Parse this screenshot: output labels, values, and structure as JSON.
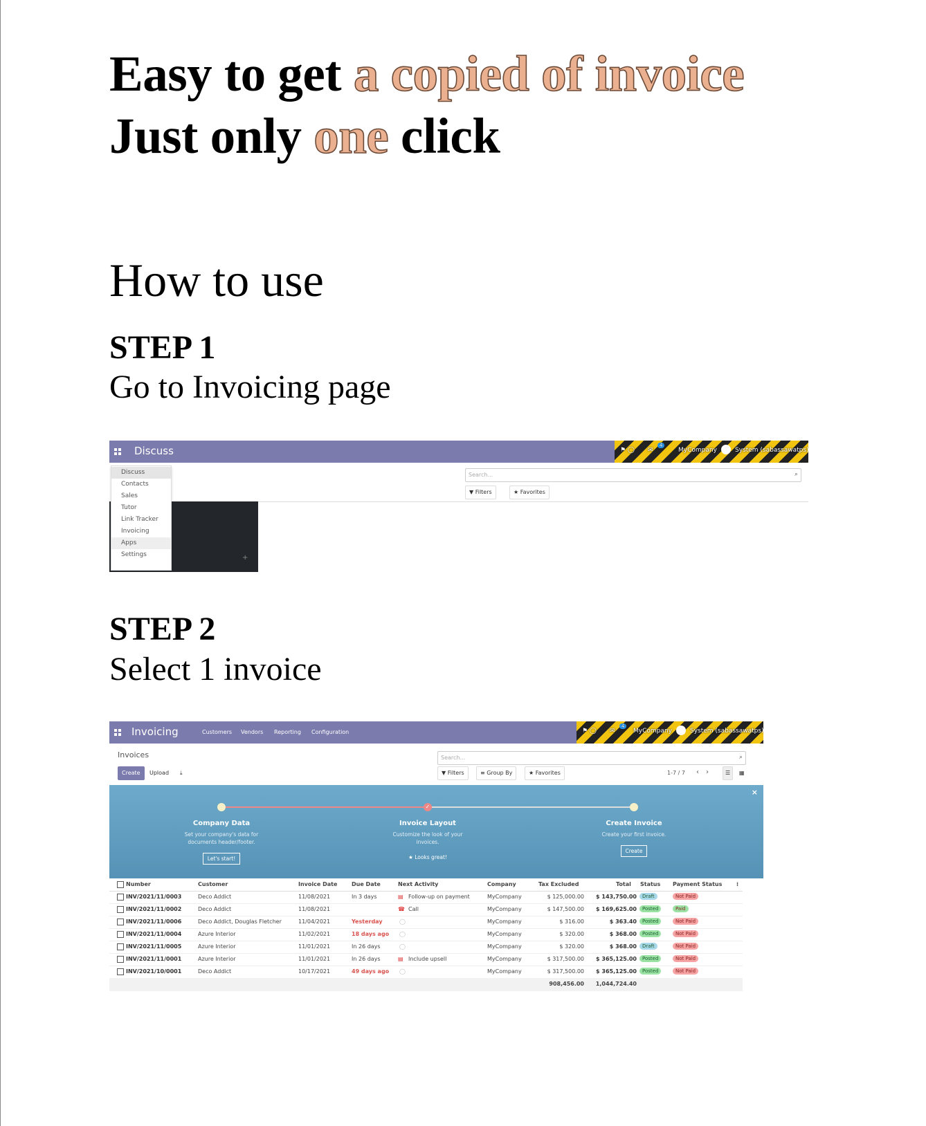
{
  "headline": {
    "line1_a": "Easy to get ",
    "line1_b": "a copied of invoice",
    "line2_a": "Just only ",
    "line2_b": "one",
    "line2_c": " click",
    "highlight_color": "#eab08f"
  },
  "howto": "How to use",
  "step1": {
    "title": "STEP 1",
    "desc": "Go to Invoicing page"
  },
  "step2": {
    "title": "STEP 2",
    "desc": "Select 1 invoice"
  },
  "shot1": {
    "app_name": "Discuss",
    "menu_items": [
      "Discuss",
      "Contacts",
      "Sales",
      "Tutor",
      "Link Tracker",
      "Invoicing",
      "Apps",
      "Settings"
    ],
    "search_placeholder": "Search...",
    "filters": "Filters",
    "favorites": "Favorites",
    "company": "MyCompany",
    "user": "System (sabassawatps)",
    "msg_count": "4",
    "plus": "+"
  },
  "shot2": {
    "app_name": "Invoicing",
    "nav": [
      "Customers",
      "Vendors",
      "Reporting",
      "Configuration"
    ],
    "breadcrumb": "Invoices",
    "create": "Create",
    "upload": "Upload",
    "search_placeholder": "Search...",
    "filters": "Filters",
    "group_by": "Group By",
    "favorites": "Favorites",
    "pager": "1-7 / 7",
    "company": "MyCompany",
    "user": "System (sabassawatps)",
    "msg_count": "4",
    "onboarding": {
      "company_title": "Company Data",
      "company_desc": "Set your company's data for documents header/footer.",
      "company_btn": "Let's start!",
      "layout_title": "Invoice Layout",
      "layout_desc": "Customize the look of your invoices.",
      "layout_done": "Looks great!",
      "invoice_title": "Create Invoice",
      "invoice_desc": "Create your first invoice.",
      "invoice_btn": "Create",
      "close": "×"
    },
    "columns": [
      "Number",
      "Customer",
      "Invoice Date",
      "Due Date",
      "Next Activity",
      "Company",
      "Tax Excluded",
      "Total",
      "Status",
      "Payment Status"
    ],
    "rows": [
      {
        "number": "INV/2021/11/0003",
        "customer": "Deco Addict",
        "date": "11/08/2021",
        "due": "In 3 days",
        "activity": "Follow-up on payment",
        "company": "MyCompany",
        "tax_excl": "$ 125,000.00",
        "total": "$ 143,750.00",
        "status": "Draft",
        "payment": "Not Paid"
      },
      {
        "number": "INV/2021/11/0002",
        "customer": "Deco Addict",
        "date": "11/08/2021",
        "due": "",
        "activity": "Call",
        "company": "MyCompany",
        "tax_excl": "$ 147,500.00",
        "total": "$ 169,625.00",
        "status": "Posted",
        "payment": "Paid"
      },
      {
        "number": "INV/2021/11/0006",
        "customer": "Deco Addict, Douglas Fletcher",
        "date": "11/04/2021",
        "due": "Yesterday",
        "activity": "",
        "company": "MyCompany",
        "tax_excl": "$ 316.00",
        "total": "$ 363.40",
        "status": "Posted",
        "payment": "Not Paid"
      },
      {
        "number": "INV/2021/11/0004",
        "customer": "Azure Interior",
        "date": "11/02/2021",
        "due": "18 days ago",
        "activity": "",
        "company": "MyCompany",
        "tax_excl": "$ 320.00",
        "total": "$ 368.00",
        "status": "Posted",
        "payment": "Not Paid"
      },
      {
        "number": "INV/2021/11/0005",
        "customer": "Azure Interior",
        "date": "11/01/2021",
        "due": "In 26 days",
        "activity": "",
        "company": "MyCompany",
        "tax_excl": "$ 320.00",
        "total": "$ 368.00",
        "status": "Draft",
        "payment": "Not Paid"
      },
      {
        "number": "INV/2021/11/0001",
        "customer": "Azure Interior",
        "date": "11/01/2021",
        "due": "In 26 days",
        "activity": "Include upsell",
        "company": "MyCompany",
        "tax_excl": "$ 317,500.00",
        "total": "$ 365,125.00",
        "status": "Posted",
        "payment": "Not Paid"
      },
      {
        "number": "INV/2021/10/0001",
        "customer": "Deco Addict",
        "date": "10/17/2021",
        "due": "49 days ago",
        "activity": "",
        "company": "MyCompany",
        "tax_excl": "$ 317,500.00",
        "total": "$ 365,125.00",
        "status": "Posted",
        "payment": "Not Paid"
      }
    ],
    "sum_tax_excl": "908,456.00",
    "sum_total": "1,044,724.40"
  },
  "colors": {
    "topbar": "#7c7bad",
    "banner": "#5b9bbd",
    "create_btn": "#7c7bad",
    "draft": "#a8d8ea",
    "posted": "#9be3a5",
    "not_paid": "#f5a3a3",
    "paid": "#9be3a5",
    "overdue": "#d9534f"
  }
}
